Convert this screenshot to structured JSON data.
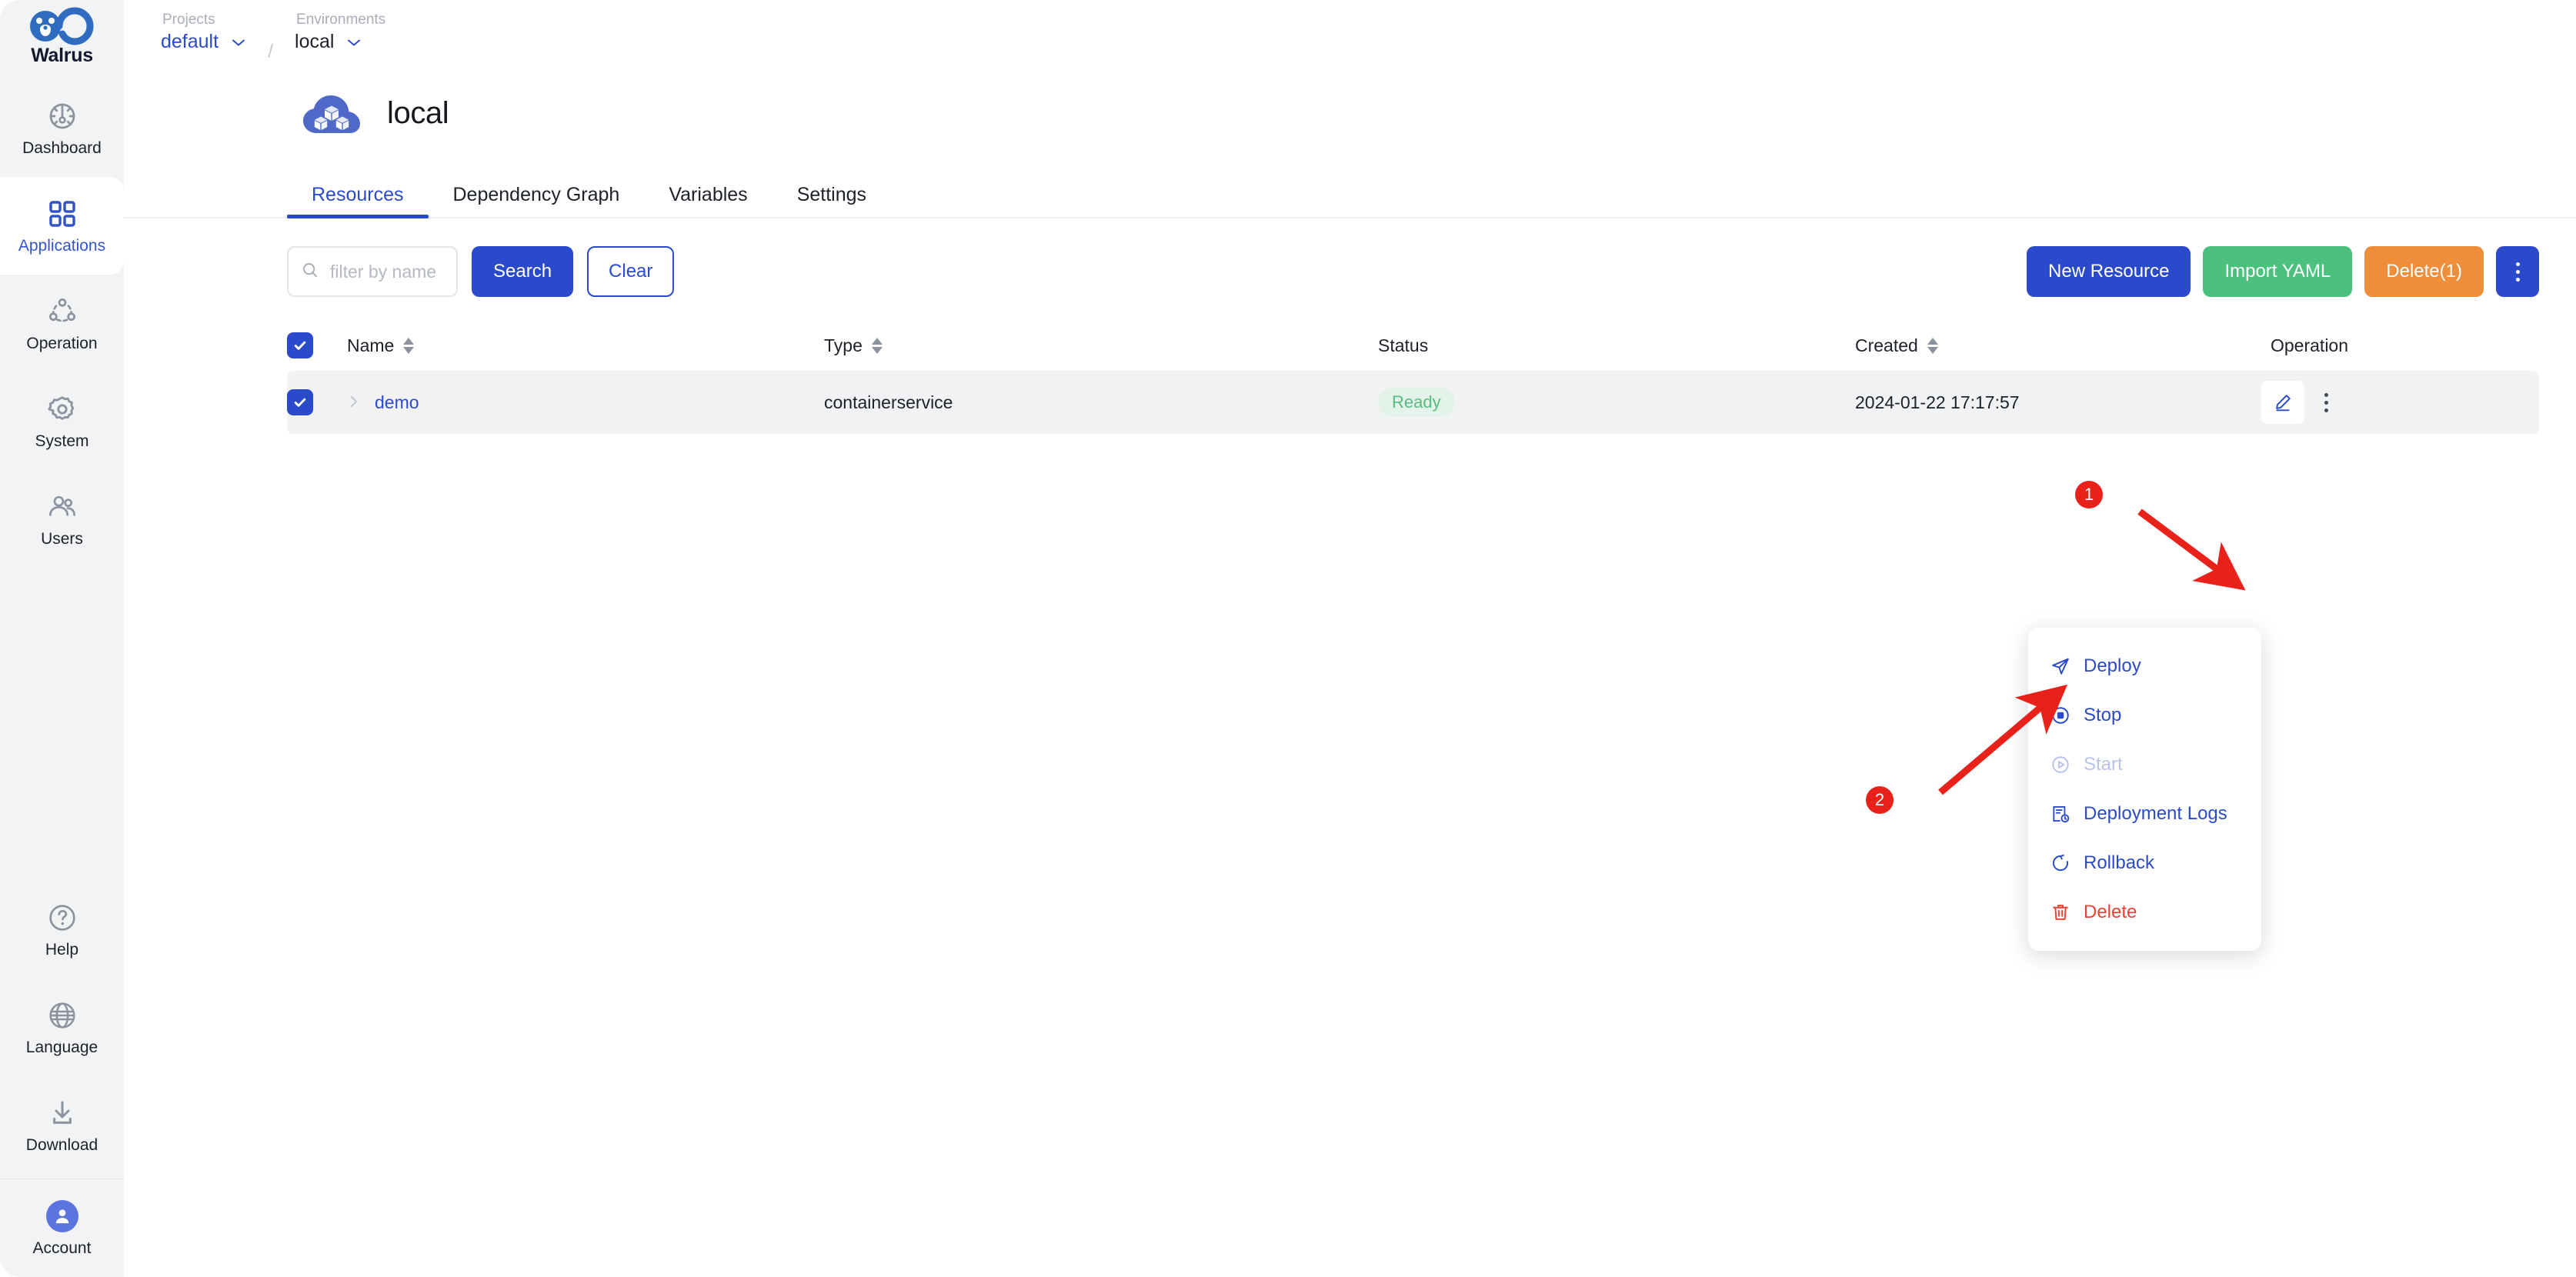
{
  "brand": {
    "name": "Walrus"
  },
  "sidebar": {
    "top_items": [
      {
        "label": "Dashboard",
        "icon": "dashboard-icon",
        "active": false
      },
      {
        "label": "Applications",
        "icon": "applications-grid-icon",
        "active": true
      },
      {
        "label": "Operation",
        "icon": "operation-nodes-icon",
        "active": false
      },
      {
        "label": "System",
        "icon": "gear-icon",
        "active": false
      },
      {
        "label": "Users",
        "icon": "users-icon",
        "active": false
      }
    ],
    "bottom_items": [
      {
        "label": "Help",
        "icon": "question-circle-icon"
      },
      {
        "label": "Language",
        "icon": "globe-icon"
      },
      {
        "label": "Download",
        "icon": "download-icon"
      },
      {
        "label": "Account",
        "icon": "avatar-icon"
      }
    ]
  },
  "breadcrumb": {
    "projects_caption": "Projects",
    "projects_value": "default",
    "separator": "/",
    "environments_caption": "Environments",
    "environments_value": "local"
  },
  "page": {
    "title": "local",
    "icon": "cloud-cubes-icon"
  },
  "tabs": [
    {
      "label": "Resources",
      "active": true
    },
    {
      "label": "Dependency Graph",
      "active": false
    },
    {
      "label": "Variables",
      "active": false
    },
    {
      "label": "Settings",
      "active": false
    }
  ],
  "toolbar": {
    "search_placeholder": "filter by name",
    "search_value": "",
    "search_button": "Search",
    "clear_button": "Clear",
    "new_resource_button": "New Resource",
    "import_yaml_button": "Import YAML",
    "delete_button": "Delete(1)",
    "more_button": "more-actions"
  },
  "table": {
    "columns": [
      {
        "label": "Name",
        "sortable": true
      },
      {
        "label": "Type",
        "sortable": true
      },
      {
        "label": "Status",
        "sortable": false
      },
      {
        "label": "Created",
        "sortable": true
      },
      {
        "label": "Operation",
        "sortable": false
      }
    ],
    "rows": [
      {
        "selected": true,
        "name": "demo",
        "type": "containerservice",
        "status": "Ready",
        "created": "2024-01-22 17:17:57"
      }
    ]
  },
  "context_menu": {
    "items": [
      {
        "label": "Deploy",
        "icon": "send-icon",
        "state": "enabled"
      },
      {
        "label": "Stop",
        "icon": "stop-circle-icon",
        "state": "enabled"
      },
      {
        "label": "Start",
        "icon": "play-circle-icon",
        "state": "disabled"
      },
      {
        "label": "Deployment Logs",
        "icon": "logs-icon",
        "state": "enabled"
      },
      {
        "label": "Rollback",
        "icon": "rollback-icon",
        "state": "enabled"
      },
      {
        "label": "Delete",
        "icon": "trash-icon",
        "state": "danger"
      }
    ]
  },
  "annotations": [
    {
      "label": "1"
    },
    {
      "label": "2"
    }
  ],
  "colors": {
    "accent_blue": "#2b4acb",
    "green": "#4cc17e",
    "orange": "#ef8e3a",
    "danger_red": "#ee4035",
    "annotation_red": "#e8221a",
    "status_ready_text": "#54bd7f",
    "status_ready_bg": "#e4f3e9",
    "sidebar_bg": "#f2f3f5",
    "row_bg": "#f1f2f4"
  }
}
